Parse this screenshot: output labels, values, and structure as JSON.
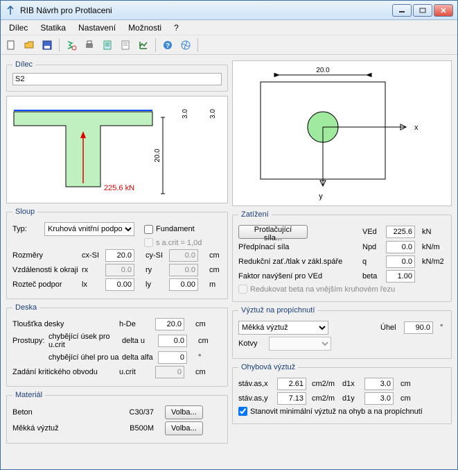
{
  "window": {
    "title": "RIB Návrh pro Protlaceni"
  },
  "menu": {
    "dilec": "Dílec",
    "statika": "Statika",
    "nastaveni": "Nastavení",
    "moznosti": "Možnosti",
    "help": "?"
  },
  "dilec": {
    "legend": "Dílec",
    "value": "S2"
  },
  "canvasL": {
    "vload": "225.6 kN",
    "dim_h": "20.0",
    "dim_v1": "3.0",
    "dim_v2": "3.0"
  },
  "canvasR": {
    "dim_w": "20.0",
    "x": "x",
    "y": "y"
  },
  "sloup": {
    "legend": "Sloup",
    "typ_label": "Typ:",
    "typ_value": "Kruhová vnitřní podpor",
    "fundament_label": "Fundament",
    "acrit_label": "s  a.crit = 1,0d",
    "rozmery": "Rozměry",
    "cxsi": "cx-SI",
    "cxsi_val": "20.0",
    "cysi": "cy-SI",
    "cysi_val": "0.0",
    "cm": "cm",
    "vzd": "Vzdálenosti k okraji",
    "rx": "rx",
    "rx_val": "0.0",
    "ry": "ry",
    "ry_val": "0.0",
    "roztec": "Rozteč podpor",
    "lx": "lx",
    "lx_val": "0.00",
    "ly": "ly",
    "ly_val": "0.00",
    "m": "m"
  },
  "deska": {
    "legend": "Deska",
    "tloustka": "Tloušťka desky",
    "hde": "h-De",
    "hde_val": "20.0",
    "cm": "cm",
    "prostupy": "Prostupy:",
    "usek": "chybějící úsek pro u.crit",
    "deltau": "delta u",
    "deltau_val": "0.0",
    "uhel": "chybějící úhel pro ua",
    "deltaalfa": "delta alfa",
    "deltaalfa_val": "0",
    "deg": "°",
    "zadani": "Zadání kritického obvodu",
    "ucrit": "u.crit",
    "ucrit_val": "0"
  },
  "material": {
    "legend": "Materiál",
    "beton": "Beton",
    "beton_val": "C30/37",
    "vyztuz": "Měkká výztuž",
    "vyztuz_val": "B500M",
    "volba": "Volba..."
  },
  "zatizeni": {
    "legend": "Zatížení",
    "protlac_btn": "Protlačující síla...",
    "ved": "VEd",
    "ved_val": "225.6",
    "kn": "kN",
    "predp": "Předpínací síla",
    "npd": "Npd",
    "npd_val": "0.0",
    "knm": "kN/m",
    "reduk": "Redukční zať./tlak v zákl.spáře",
    "q": "q",
    "q_val": "0.0",
    "knm2": "kN/m2",
    "faktor": "Faktor navýšení pro VEd",
    "beta": "beta",
    "beta_val": "1.00",
    "redukovat": "Redukovat beta na vnějším kruhovém řezu"
  },
  "vyztuz_pr": {
    "legend": "Výztuž na propíchnutí",
    "drop_val": "Měkká výztuž",
    "uhel": "Úhel",
    "uhel_val": "90.0",
    "deg": "°",
    "kotvy": "Kotvy"
  },
  "ohyb": {
    "legend": "Ohybová výztuž",
    "stavx": "stáv.as,x",
    "stavx_val": "2.61",
    "cm2m": "cm2/m",
    "d1x": "d1x",
    "d1x_val": "3.0",
    "cm": "cm",
    "stavy": "stáv.as,y",
    "stavy_val": "7.13",
    "d1y": "d1y",
    "d1y_val": "3.0",
    "stanovit": "Stanovit minimální výztuž na ohyb a na propíchnutí"
  }
}
